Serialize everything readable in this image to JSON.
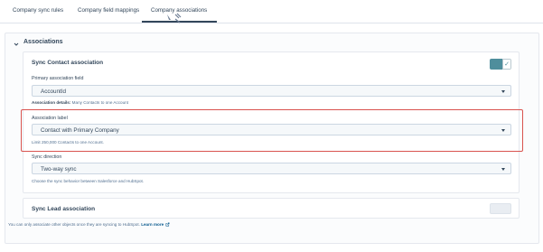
{
  "tabs": [
    {
      "label": "Company sync rules"
    },
    {
      "label": "Company field mappings"
    },
    {
      "label": "Company associations"
    }
  ],
  "associations": {
    "title": "Associations",
    "contact": {
      "title": "Sync Contact association",
      "enabled": true,
      "primary_field_label": "Primary association field",
      "primary_field_value": "AccountId",
      "details_bold": "Association details:",
      "details_text": " Many Contacts to one Account",
      "assoc_label_label": "Association label",
      "assoc_label_value": "Contact with Primary Company",
      "assoc_label_help": "Limit 250,000 Contacts to one Account.",
      "sync_direction_label": "Sync direction",
      "sync_direction_value": "Two-way sync",
      "sync_direction_help": "Choose the sync behavior between Salesforce and HubSpot."
    },
    "lead": {
      "title": "Sync Lead association",
      "enabled": false
    }
  },
  "footer": {
    "note": "You can only associate other objects once they are syncing to HubSpot.",
    "link": "Learn more"
  },
  "colors": {
    "accent": "#4f8e9c",
    "highlight": "#d9534f",
    "text": "#33475b"
  }
}
